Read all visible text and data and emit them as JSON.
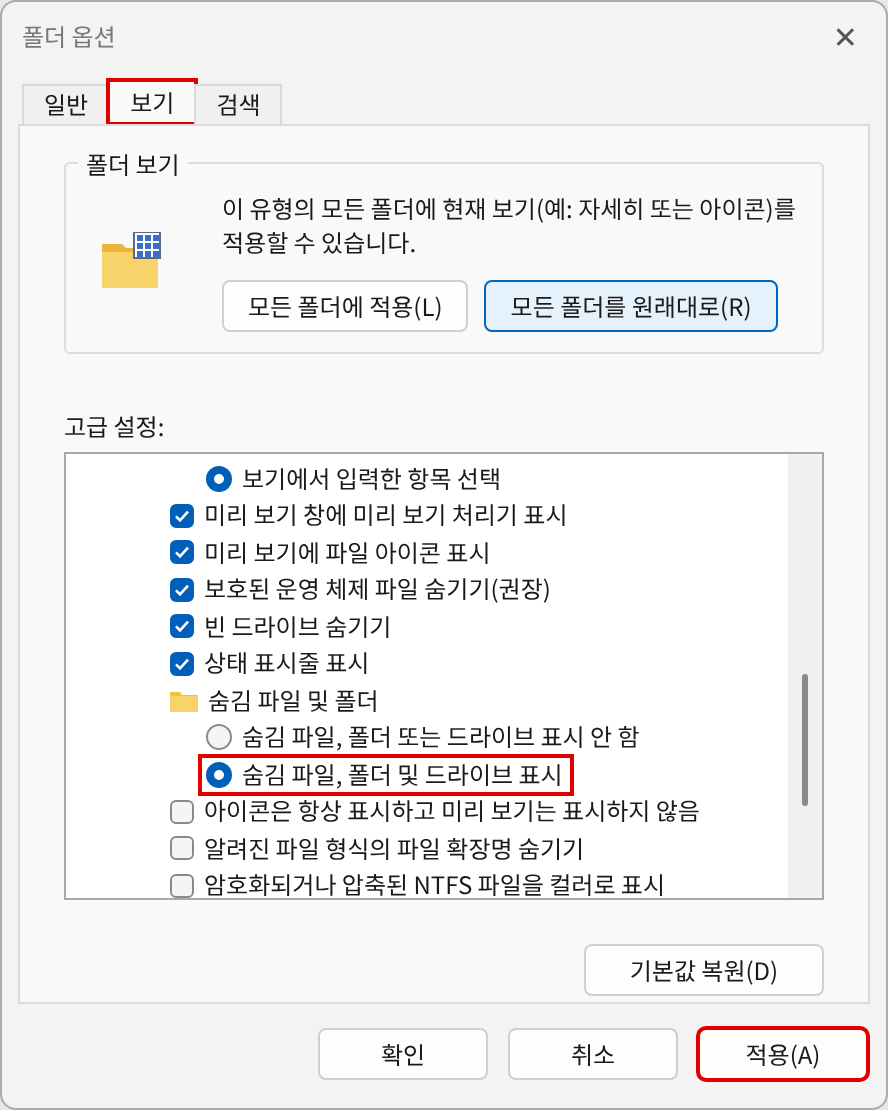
{
  "window": {
    "title": "폴더 옵션",
    "close": "✕"
  },
  "tabs": [
    {
      "label": "일반",
      "selected": false,
      "highlighted": false
    },
    {
      "label": "보기",
      "selected": true,
      "highlighted": true
    },
    {
      "label": "검색",
      "selected": false,
      "highlighted": false
    }
  ],
  "folder_views": {
    "title": "폴더 보기",
    "description": "이 유형의 모든 폴더에 현재 보기(예: 자세히 또는 아이콘)를 적용할 수 있습니다.",
    "buttons": [
      {
        "label": "모든 폴더에 적용(L)",
        "focused": false
      },
      {
        "label": "모든 폴더를 원래대로(R)",
        "focused": true
      }
    ]
  },
  "advanced": {
    "title": "고급 설정:",
    "items": [
      {
        "kind": "radio",
        "label": "보기에서 입력한 항목 선택",
        "selected": true,
        "highlighted": false
      },
      {
        "kind": "checkbox",
        "label": "미리 보기 창에 미리 보기 처리기 표시",
        "checked": true,
        "highlighted": false
      },
      {
        "kind": "checkbox",
        "label": "미리 보기에 파일 아이콘 표시",
        "checked": true,
        "highlighted": false
      },
      {
        "kind": "checkbox",
        "label": "보호된 운영 체제 파일 숨기기(권장)",
        "checked": true,
        "highlighted": false
      },
      {
        "kind": "checkbox",
        "label": "빈 드라이브 숨기기",
        "checked": true,
        "highlighted": false
      },
      {
        "kind": "checkbox",
        "label": "상태 표시줄 표시",
        "checked": true,
        "highlighted": false
      },
      {
        "kind": "folder",
        "label": "숨김 파일 및 폴더",
        "highlighted": false
      },
      {
        "kind": "radio",
        "label": "숨김 파일, 폴더 또는 드라이브 표시 안 함",
        "selected": false,
        "highlighted": false
      },
      {
        "kind": "radio",
        "label": "숨김 파일, 폴더 및 드라이브 표시",
        "selected": true,
        "highlighted": true
      },
      {
        "kind": "checkbox",
        "label": "아이콘은 항상 표시하고 미리 보기는 표시하지 않음",
        "checked": false,
        "highlighted": false
      },
      {
        "kind": "checkbox",
        "label": "알려진 파일 형식의 파일 확장명 숨기기",
        "checked": false,
        "highlighted": false
      },
      {
        "kind": "checkbox",
        "label": "암호화되거나 압축된 NTFS 파일을 컬러로 표시",
        "checked": false,
        "highlighted": false
      }
    ],
    "restore_button": "기본값 복원(D)"
  },
  "buttons": [
    {
      "label": "확인",
      "highlighted": false
    },
    {
      "label": "취소",
      "highlighted": false
    },
    {
      "label": "적용(A)",
      "highlighted": true
    }
  ]
}
